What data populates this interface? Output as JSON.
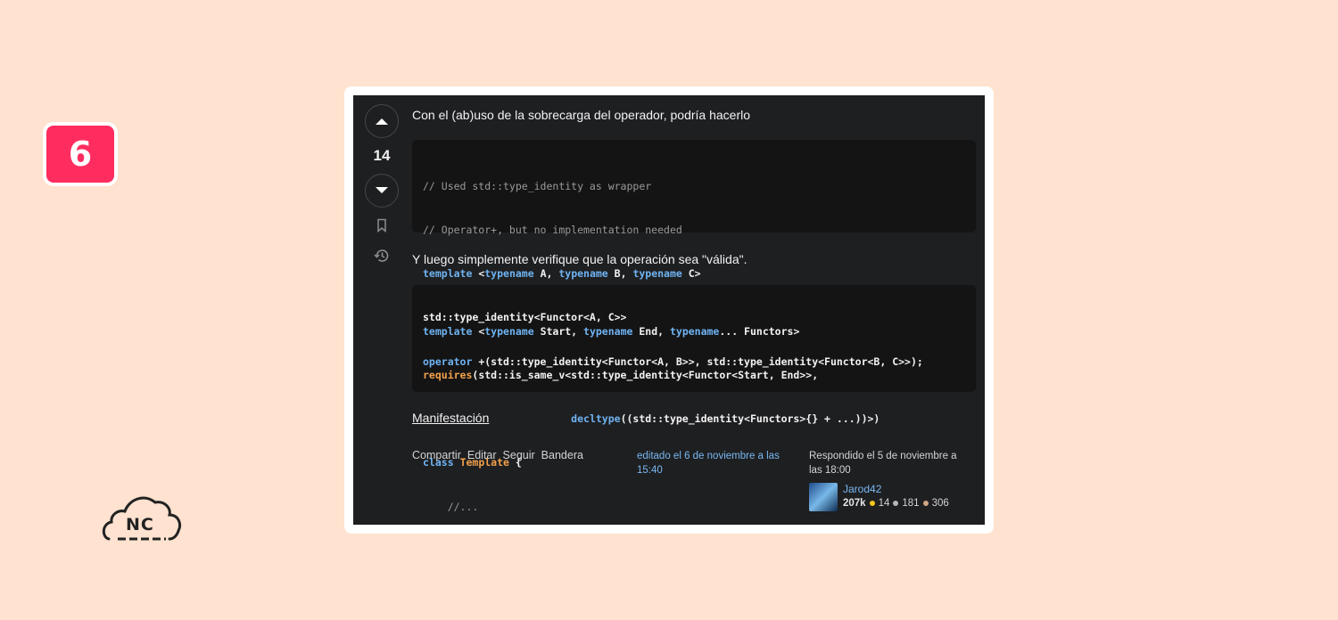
{
  "badge": {
    "number": "6"
  },
  "logo": {
    "text": "NC"
  },
  "post": {
    "vote_count": "14",
    "intro": "Con el (ab)uso de la sobrecarga del operador, podría hacerlo",
    "middle": "Y luego simplemente verifique que la operación sea \"válida\".",
    "link_label": "Manifestación",
    "code1": [
      "// Used std::type_identity as wrapper",
      "// Operator+, but no implementation needed",
      [
        "template",
        " <",
        "typename",
        " A, ",
        "typename",
        " B, ",
        "typename",
        " C>"
      ],
      "std::type_identity<Functor<A, C>>",
      [
        "operator",
        " +(std::type_identity<Functor<A, B>>, std::type_identity<Functor<B, C>>);"
      ]
    ],
    "code2": [
      [
        "template",
        " <",
        "typename",
        " Start, ",
        "typename",
        " End, ",
        "typename",
        "... Functors>"
      ],
      [
        "requires",
        "(std::is_same_v<std::type_identity<Functor<Start, End>>,"
      ],
      [
        "                        ",
        "decltype",
        "((std::type_identity<Functors>{} + ...))>)"
      ],
      [
        "class",
        " ",
        "Template",
        " {"
      ],
      "    //...",
      "};"
    ]
  },
  "footer": {
    "actions": [
      "Compartir",
      "Editar",
      "Seguir",
      "Bandera"
    ],
    "edited": "editado el 6 de noviembre a las 15:40",
    "answered": "Respondido el 5 de noviembre a las 18:00",
    "user": {
      "name": "Jarod42",
      "reputation": "207k",
      "gold": "14",
      "silver": "181",
      "bronze": "306"
    }
  },
  "colors": {
    "gold": "#f5c518",
    "silver": "#b4b8bc",
    "bronze": "#d1a684"
  }
}
